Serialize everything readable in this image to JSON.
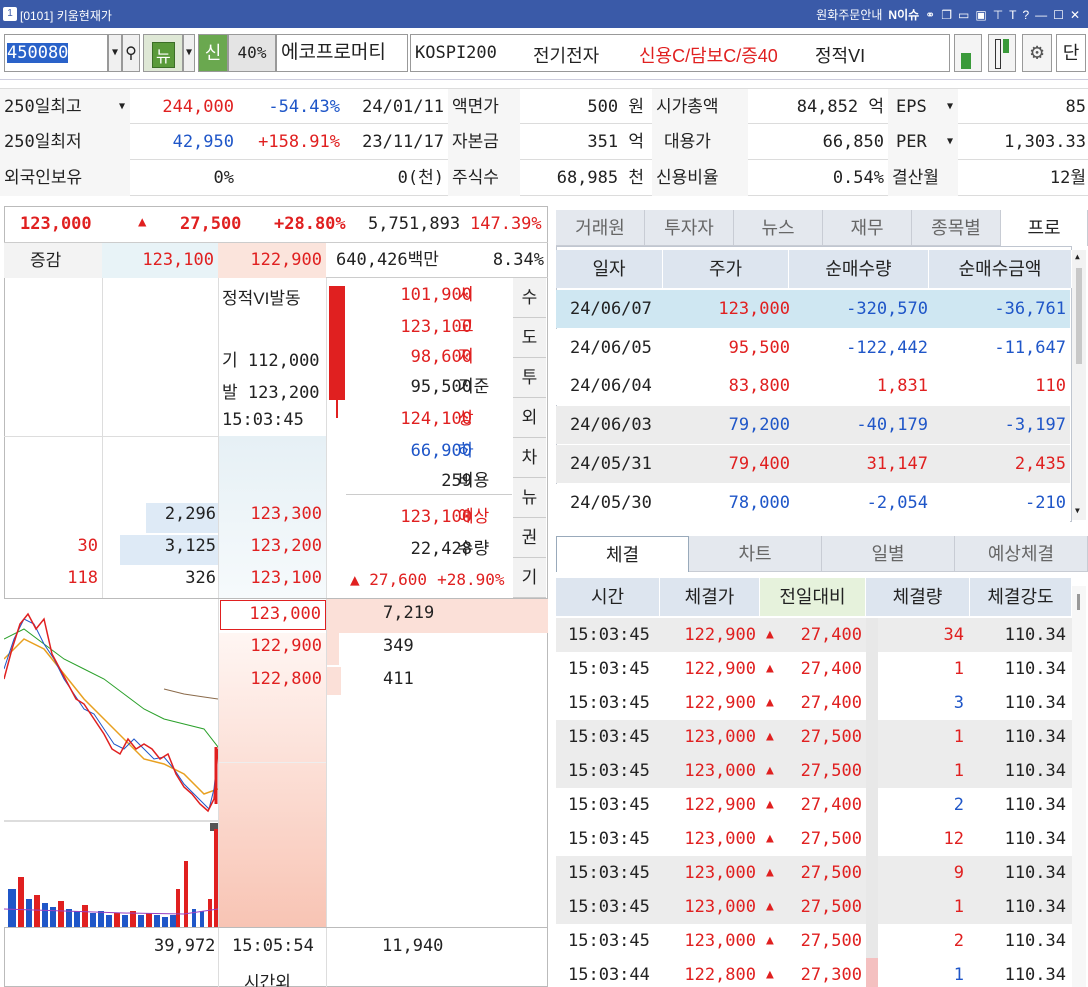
{
  "window": {
    "number": "1",
    "title": "[0101] 키움현재가",
    "right_items": [
      "원화주문안내",
      "N이슈"
    ]
  },
  "toolbar": {
    "code": "450080",
    "news_btn": "뉴",
    "credit_btn": "신",
    "margin": "40%",
    "stock_name": "에코프로머티",
    "index": "KOSPI200",
    "sector": "전기전자",
    "credit_info": "신용C/담보C/증40",
    "vi": "정적VI",
    "dan": "단"
  },
  "info": {
    "r1": {
      "label": "250일최고",
      "value": "244,000",
      "pct": "-54.43%",
      "date": "24/01/11",
      "l2": "액면가",
      "v2": "500 원",
      "l3": "시가총액",
      "v3": "84,852 억",
      "l4": "EPS",
      "v4": "85"
    },
    "r2": {
      "label": "250일최저",
      "value": "42,950",
      "pct": "+158.91%",
      "date": "23/11/17",
      "l2": "자본금",
      "v2": "351 억",
      "l3": "대용가",
      "v3": "66,850",
      "l4": "PER",
      "v4": "1,303.33"
    },
    "r3": {
      "label": "외국인보유",
      "value": "0%",
      "pct": "0(천)",
      "l2": "주식수",
      "v2": "68,985 천",
      "l3": "신용비율",
      "v3": "0.54%",
      "l4": "결산월",
      "v4": "12월"
    }
  },
  "quote": {
    "price": "123,000",
    "arrow": "▲",
    "change": "27,500",
    "pct": "+28.80%",
    "volume": "5,751,893",
    "vol_pct": "147.39%",
    "row2": {
      "label": "증감",
      "ask": "123,100",
      "bid": "122,900",
      "amount": "640,426백만",
      "ratio": "8.34%"
    },
    "vi": {
      "title": "정적VI발동",
      "base_label": "기",
      "base": "112,000",
      "trig_label": "발",
      "trig": "123,200",
      "time": "15:03:45"
    },
    "stats": [
      {
        "v": "101,900",
        "l": "시",
        "c": "red"
      },
      {
        "v": "123,100",
        "l": "고",
        "c": "red"
      },
      {
        "v": "98,600",
        "l": "저",
        "c": "red"
      },
      {
        "v": "95,500",
        "l": "기준",
        "c": "dark"
      },
      {
        "v": "124,100",
        "l": "상",
        "c": "red"
      },
      {
        "v": "66,900",
        "l": "하",
        "c": "blue"
      },
      {
        "v": "259",
        "l": "비용",
        "c": "dark"
      },
      {
        "v": "123,100",
        "l": "예상",
        "c": "red"
      },
      {
        "v": "22,428",
        "l": "수량",
        "c": "dark"
      }
    ],
    "exp_change": "▲ 27,600",
    "exp_pct": "+28.90%",
    "side_tabs": [
      "수",
      "도",
      "투",
      "외",
      "차",
      "뉴",
      "권",
      "기"
    ],
    "asks": [
      {
        "chg": "",
        "qty": "2,296",
        "price": "123,300"
      },
      {
        "chg": "30",
        "qty": "3,125",
        "price": "123,200"
      },
      {
        "chg": "118",
        "qty": "326",
        "price": "123,100"
      }
    ],
    "bids": [
      {
        "price": "123,000",
        "qty": "7,219"
      },
      {
        "price": "122,900",
        "qty": "349"
      },
      {
        "price": "122,800",
        "qty": "411"
      }
    ],
    "footer": {
      "total_ask": "39,972",
      "time": "15:05:54",
      "total_bid": "11,940",
      "after": "시간외"
    }
  },
  "investor_tabs": [
    "거래원",
    "투자자",
    "뉴스",
    "재무",
    "종목별",
    "프로"
  ],
  "investor_headers": [
    "일자",
    "주가",
    "순매수량",
    "순매수금액"
  ],
  "investor_rows": [
    {
      "date": "24/06/07",
      "price": "123,000",
      "qty": "-320,570",
      "amt": "-36,761",
      "pc": "red",
      "qc": "blue",
      "ac": "blue"
    },
    {
      "date": "24/06/05",
      "price": "95,500",
      "qty": "-122,442",
      "amt": "-11,647",
      "pc": "red",
      "qc": "blue",
      "ac": "blue"
    },
    {
      "date": "24/06/04",
      "price": "83,800",
      "qty": "1,831",
      "amt": "110",
      "pc": "red",
      "qc": "red",
      "ac": "red"
    },
    {
      "date": "24/06/03",
      "price": "79,200",
      "qty": "-40,179",
      "amt": "-3,197",
      "pc": "blue",
      "qc": "blue",
      "ac": "blue"
    },
    {
      "date": "24/05/31",
      "price": "79,400",
      "qty": "31,147",
      "amt": "2,435",
      "pc": "red",
      "qc": "red",
      "ac": "red"
    },
    {
      "date": "24/05/30",
      "price": "78,000",
      "qty": "-2,054",
      "amt": "-210",
      "pc": "blue",
      "qc": "blue",
      "ac": "blue"
    }
  ],
  "trade_tabs": [
    "체결",
    "차트",
    "일별",
    "예상체결"
  ],
  "trade_headers": [
    "시간",
    "체결가",
    "전일대비",
    "체결량",
    "체결강도"
  ],
  "trade_rows": [
    {
      "t": "15:03:45",
      "p": "122,900",
      "c": "27,400",
      "q": "34",
      "s": "110.34",
      "qc": "red"
    },
    {
      "t": "15:03:45",
      "p": "122,900",
      "c": "27,400",
      "q": "1",
      "s": "110.34",
      "qc": "red"
    },
    {
      "t": "15:03:45",
      "p": "122,900",
      "c": "27,400",
      "q": "3",
      "s": "110.34",
      "qc": "blue"
    },
    {
      "t": "15:03:45",
      "p": "123,000",
      "c": "27,500",
      "q": "1",
      "s": "110.34",
      "qc": "red"
    },
    {
      "t": "15:03:45",
      "p": "123,000",
      "c": "27,500",
      "q": "1",
      "s": "110.34",
      "qc": "red"
    },
    {
      "t": "15:03:45",
      "p": "122,900",
      "c": "27,400",
      "q": "2",
      "s": "110.34",
      "qc": "blue"
    },
    {
      "t": "15:03:45",
      "p": "123,000",
      "c": "27,500",
      "q": "12",
      "s": "110.34",
      "qc": "red"
    },
    {
      "t": "15:03:45",
      "p": "123,000",
      "c": "27,500",
      "q": "9",
      "s": "110.34",
      "qc": "red"
    },
    {
      "t": "15:03:45",
      "p": "123,000",
      "c": "27,500",
      "q": "1",
      "s": "110.34",
      "qc": "red"
    },
    {
      "t": "15:03:45",
      "p": "123,000",
      "c": "27,500",
      "q": "2",
      "s": "110.34",
      "qc": "red"
    },
    {
      "t": "15:03:44",
      "p": "122,800",
      "c": "27,300",
      "q": "1",
      "s": "110.34",
      "qc": "blue"
    }
  ],
  "arrow_up": "▲",
  "colors": {
    "up": "#e02020",
    "down": "#1f56c8",
    "titlebar": "#3a5aa8"
  }
}
